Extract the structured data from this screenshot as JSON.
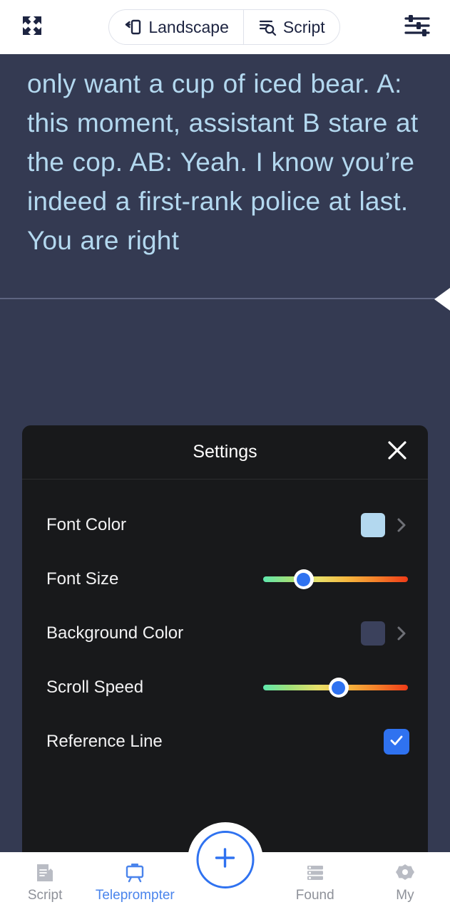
{
  "topbar": {
    "fullscreen_icon": "fullscreen-expand-icon",
    "prefs_icon": "sliders-settings-icon",
    "segments": [
      {
        "label": "Landscape",
        "icon": "rotate-screen-icon"
      },
      {
        "label": "Script",
        "icon": "document-search-icon"
      }
    ]
  },
  "script": {
    "text": "only want a cup of iced bear. A: this moment, assistant B stare at the cop. AB: Yeah. I know you’re indeed a first-rank police at last. You are right",
    "font_color": "#b3d8ef",
    "background_color": "#343a52",
    "reference_line_color": "#5d6480",
    "reference_marker_icon": "left-triangle-marker-icon"
  },
  "player": {
    "play_icon": "play-triangle-icon"
  },
  "settings": {
    "title": "Settings",
    "close_icon": "close-icon",
    "rows": [
      {
        "label": "Font Color",
        "type": "color",
        "value": "#b3d8ef",
        "chevron_icon": "chevron-right-icon"
      },
      {
        "label": "Font Size",
        "type": "slider",
        "value_percent": 28
      },
      {
        "label": "Background Color",
        "type": "color",
        "value": "#3b415c",
        "chevron_icon": "chevron-right-icon"
      },
      {
        "label": "Scroll Speed",
        "type": "slider",
        "value_percent": 52
      },
      {
        "label": "Reference Line",
        "type": "checkbox",
        "checked": true,
        "check_icon": "check-icon"
      }
    ],
    "accent_color": "#2f72f0"
  },
  "bottom_nav": {
    "active_color": "#4a84ec",
    "inactive_color": "#8e9199",
    "items": [
      {
        "label": "Script",
        "icon": "document-bookmark-icon",
        "active": false
      },
      {
        "label": "Teleprompter",
        "icon": "teleprompter-stand-icon",
        "active": true
      },
      {
        "label": "Found",
        "icon": "list-rows-icon",
        "active": false
      },
      {
        "label": "My",
        "icon": "gear-icon",
        "active": false
      }
    ],
    "fab": {
      "icon": "plus-icon",
      "color": "#2f72f0"
    }
  }
}
